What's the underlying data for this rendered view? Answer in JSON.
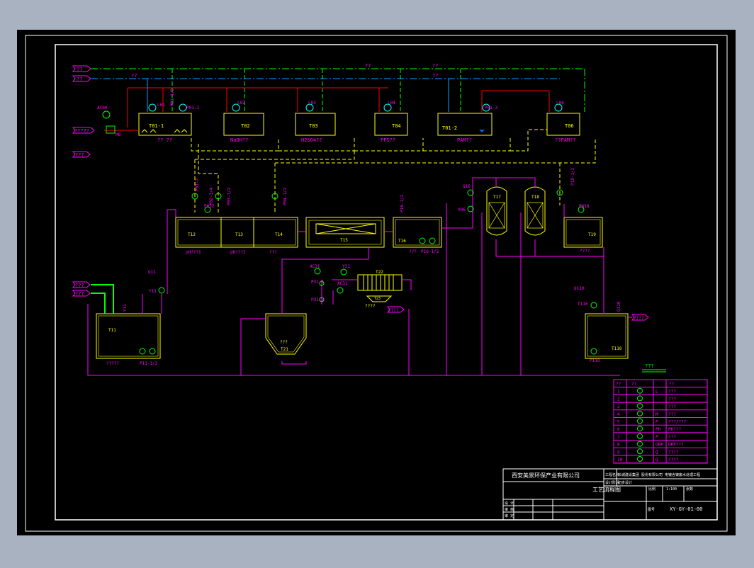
{
  "colors": {
    "background": "#000000",
    "frame": "#ffffff",
    "equipment": "#ffff00",
    "pipe_main": "#ff00ff",
    "pipe_air": "#00ff00",
    "pipe_red": "#ff0000",
    "pipe_dashed": "#ffff00",
    "pipe_blue": "#00a0ff",
    "text_label": "#ff00ff",
    "text_equipment": "#ffff00"
  },
  "inlets": {
    "top_1": "??",
    "top_2": "??",
    "dosing_in": "?????",
    "dosing_in_2": "???",
    "bottom_1": "???",
    "bottom_2": "???"
  },
  "top_line_labels": {
    "l1": "??",
    "l2": "??",
    "l3": "??",
    "l4": "??"
  },
  "dosing_tanks": [
    {
      "id": "T01",
      "tag": "T01-1",
      "caption": "?? ??",
      "level": "L01",
      "pump": "M01-1/2",
      "meter": "P01-1"
    },
    {
      "id": "T02",
      "tag": "T02",
      "caption": "NaOH??",
      "level": "L02"
    },
    {
      "id": "T03",
      "tag": "T03",
      "caption": "H2SO4??",
      "level": "L03"
    },
    {
      "id": "T04",
      "tag": "T04",
      "caption": "PFS??",
      "level": "L04"
    },
    {
      "id": "T05",
      "tag": "T01-2",
      "caption": "PAM??",
      "level": "L01",
      "meter": "P01-3"
    },
    {
      "id": "T06",
      "tag": "T06",
      "caption": "??PAM??",
      "level": "L06"
    }
  ],
  "process": {
    "ac00": "AC00",
    "m8": "M8",
    "p1": "P01-2",
    "p2": "P02-3/4",
    "p3": "P03-1/2",
    "p4": "P04-1/2",
    "ph12": "PH12",
    "tank_t12": "T12",
    "tank_t13": "T13",
    "tank_t14": "T14",
    "caption_ph1": "pH???1",
    "caption_ph2": "pH???2",
    "caption_t14": "???",
    "tank_t15": "T15",
    "tank_t16": "T16",
    "caption_t16": "???",
    "p16": "P16-1/2",
    "p16b": "P16-1/2",
    "q16": "Q16",
    "v06": "V06",
    "t17": "T17",
    "t18": "T18",
    "tank_t19": "T19",
    "caption_t19": "????",
    "p19": "P19-1/2",
    "pw18": "PW18",
    "tank_t11": "T11",
    "caption_t11": "?????",
    "p11": "P11-1/2",
    "q11": "Q11",
    "y11": "Y11",
    "t21": "T21",
    "t20": "T20",
    "caption_t20": "???",
    "ac31": "AC31",
    "y31": "Y31",
    "p31": "P31-1",
    "p32": "P31-2",
    "ac32": "AC31",
    "t22": "T22",
    "t23": "T23",
    "caption_t23": "????",
    "outlet_sludge": "????",
    "q110": "Q110",
    "t116": "T116",
    "tank_t110": "T110",
    "p110": "P110",
    "outlet_final": "????",
    "outlet_label": "???"
  },
  "legend": {
    "title": "? ?",
    "header": [
      "??",
      "??",
      "??"
    ],
    "rows": [
      {
        "no": "1",
        "sym": "circle-flow",
        "code": "L",
        "desc": "???"
      },
      {
        "no": "2",
        "sym": "check-valve",
        "code": "",
        "desc": "???"
      },
      {
        "no": "3",
        "sym": "gate-valve",
        "code": "",
        "desc": "???"
      },
      {
        "no": "4",
        "sym": "ball-valve",
        "code": "M",
        "desc": "???"
      },
      {
        "no": "5",
        "sym": "pump",
        "code": "P",
        "desc": "???/???"
      },
      {
        "no": "6",
        "sym": "ph-meter",
        "code": "PH",
        "desc": "PH???"
      },
      {
        "no": "7",
        "sym": "pressure",
        "code": "P",
        "desc": "???"
      },
      {
        "no": "8",
        "sym": "orp-meter",
        "code": "ORP",
        "desc": "ORP???"
      },
      {
        "no": "9",
        "sym": "flowmeter",
        "code": "Q",
        "desc": "????"
      },
      {
        "no": "10",
        "sym": "motor",
        "code": "Q",
        "desc": "????"
      }
    ]
  },
  "title_block": {
    "company": "西安美景环保产业有限公司",
    "project_label": "工程名称",
    "project": "长城建设集团 股份有限公司 电镀含镍废水处理工程",
    "stage_label": "设计阶段",
    "stage": "初步设计",
    "drawing_title": "工艺流程图",
    "scale_label": "比例",
    "scale": "1:100",
    "sheet_label": "张数",
    "drawing_no_label": "图号",
    "drawing_no": "XY-GY-01-00",
    "design": "设 计",
    "check": "审 核",
    "approve": "审 定"
  }
}
